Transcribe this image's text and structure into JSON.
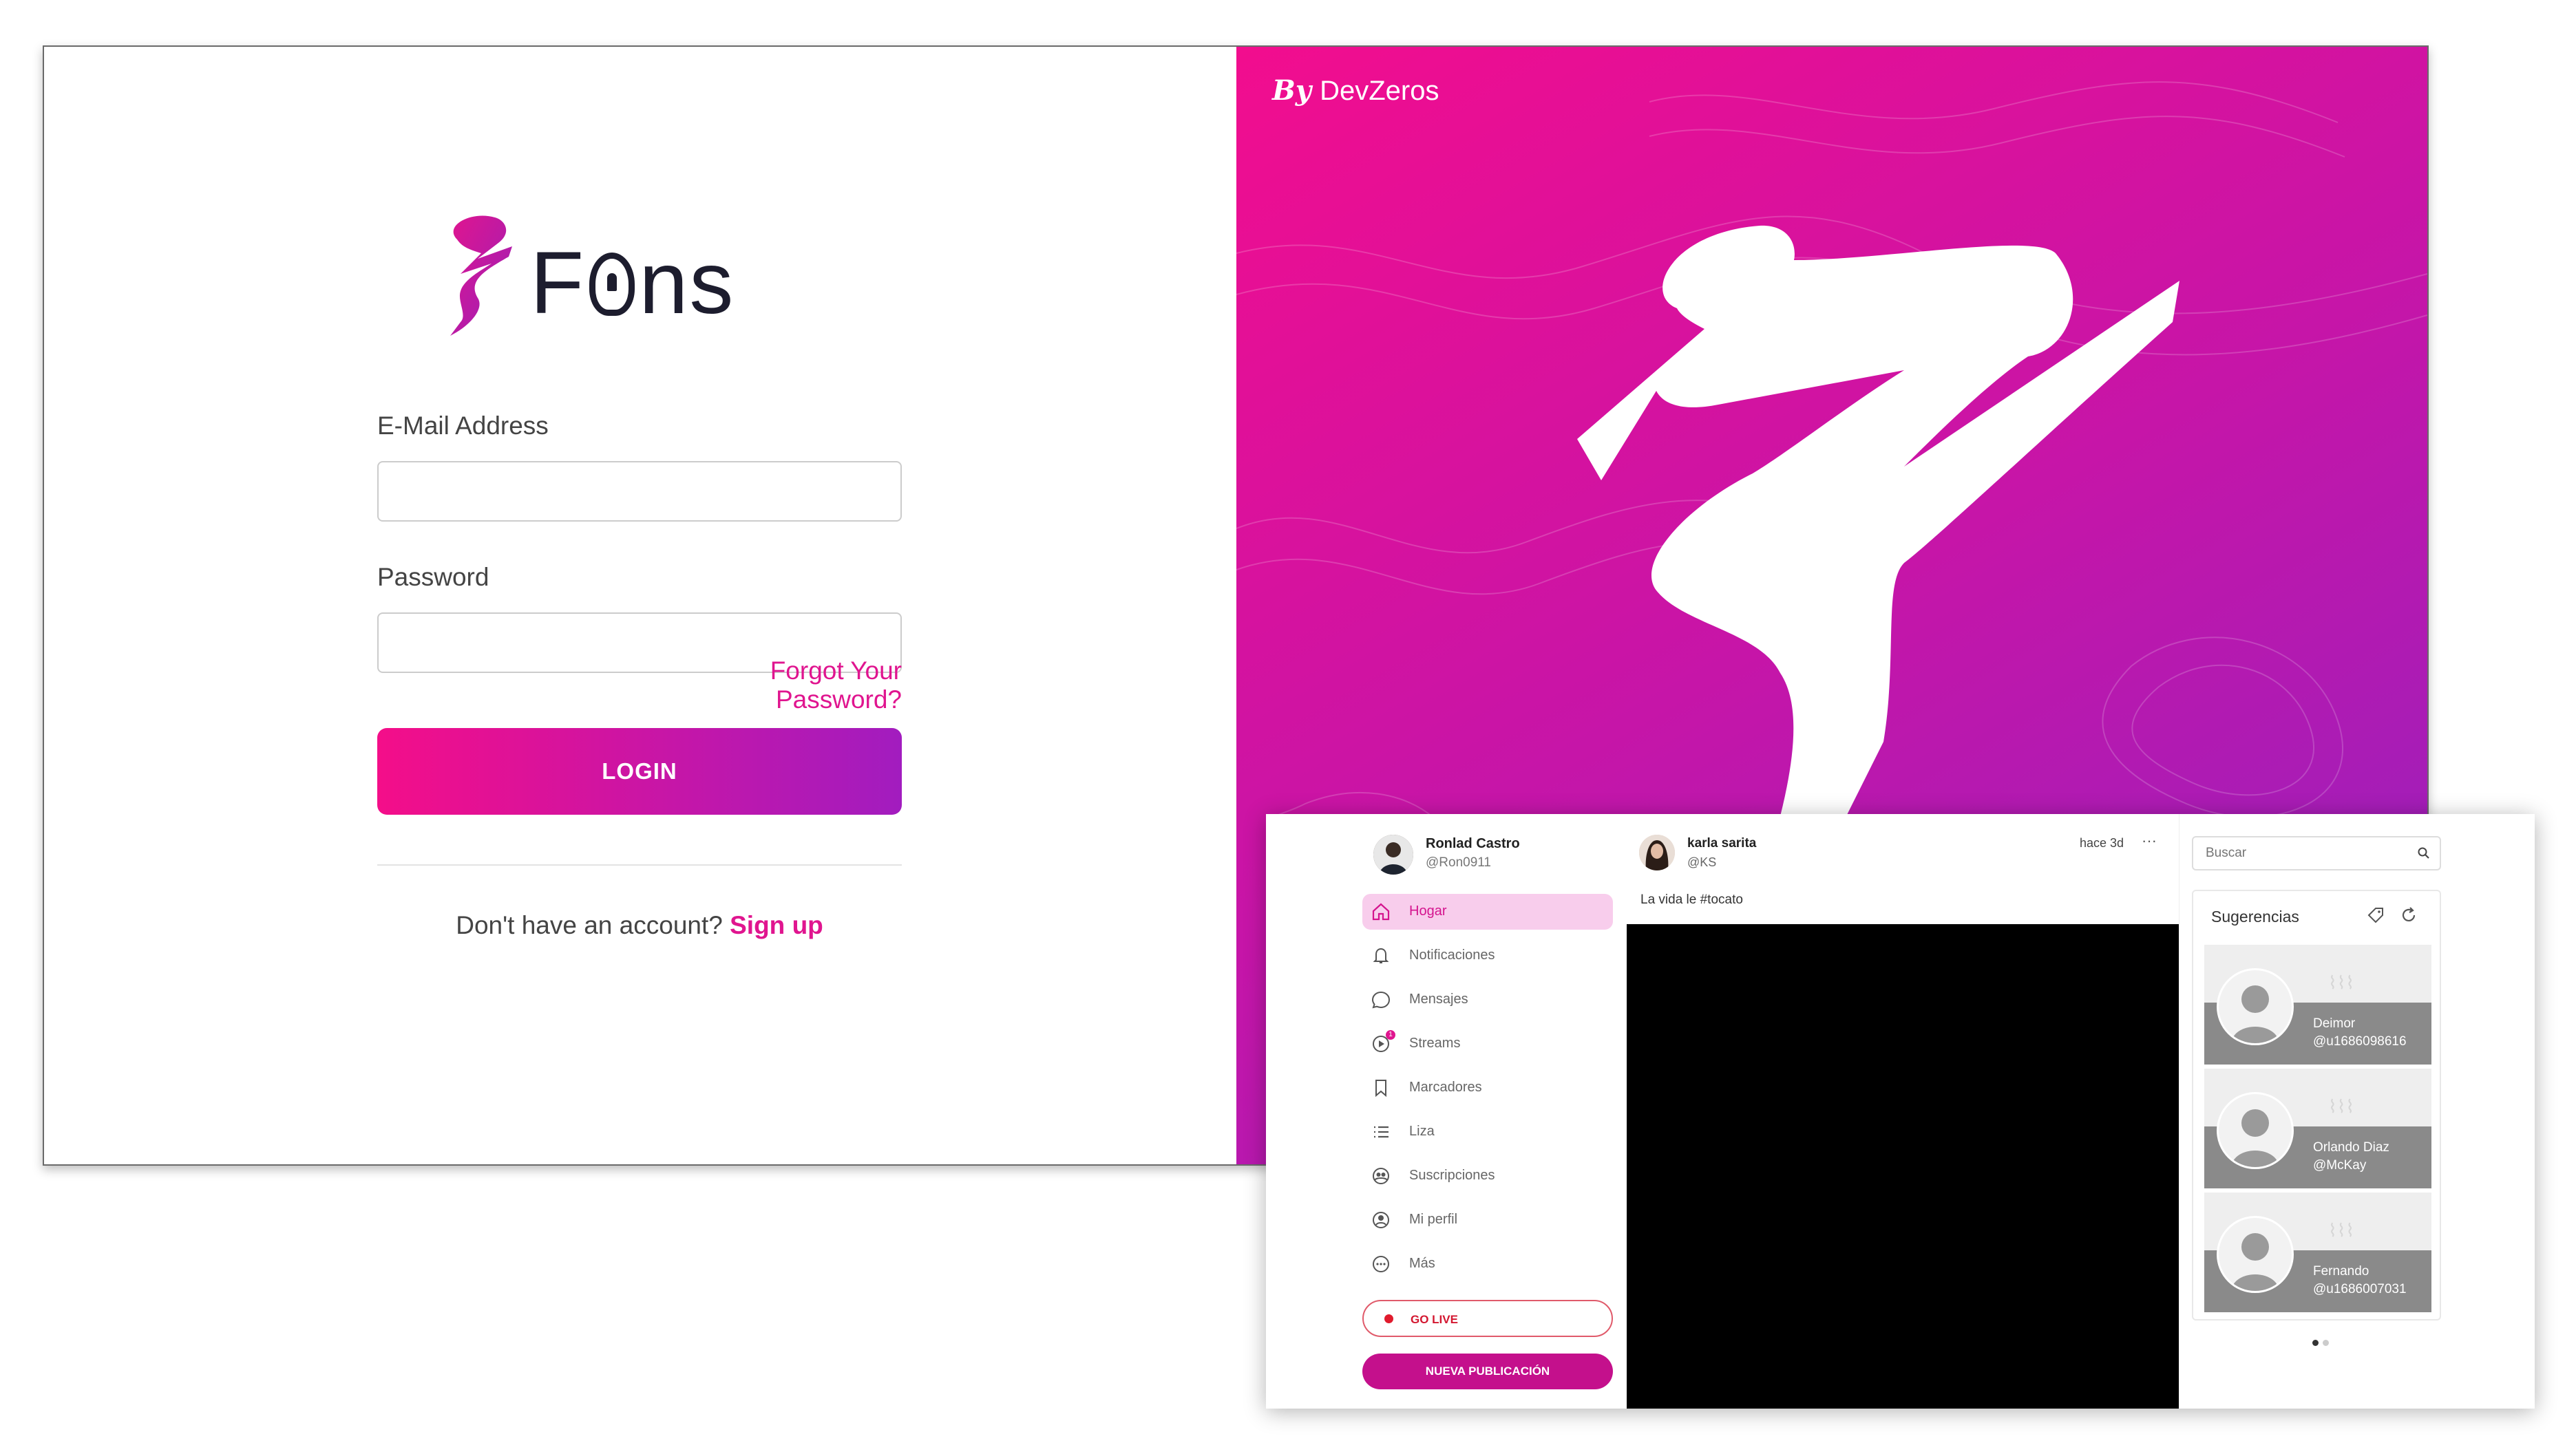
{
  "login": {
    "brand_name": "Fans",
    "email_label": "E-Mail Address",
    "email_value": "",
    "password_label": "Password",
    "password_value": "",
    "forgot_password": "Forgot Your Password?",
    "login_button": "LOGIN",
    "no_account_text": "Don't have an account?",
    "signup_link": "Sign up",
    "credit_by": "By",
    "credit_name": "DevZeros",
    "colors": {
      "accent": "#e0158f",
      "gradient_start": "#f40e89",
      "gradient_end": "#a21cbf"
    }
  },
  "app": {
    "profile": {
      "name": "Ronlad Castro",
      "handle": "@Ron0911"
    },
    "nav": [
      {
        "label": "Hogar",
        "icon": "home-icon",
        "active": true
      },
      {
        "label": "Notificaciones",
        "icon": "bell-icon"
      },
      {
        "label": "Mensajes",
        "icon": "chat-bubble-icon"
      },
      {
        "label": "Streams",
        "icon": "play-icon",
        "badge": "1"
      },
      {
        "label": "Marcadores",
        "icon": "bookmark-icon"
      },
      {
        "label": "Liza",
        "icon": "list-icon"
      },
      {
        "label": "Suscripciones",
        "icon": "subscriptions-icon"
      },
      {
        "label": "Mi perfil",
        "icon": "user-circle-icon"
      },
      {
        "label": "Más",
        "icon": "more-icon"
      }
    ],
    "go_live": "GO LIVE",
    "new_post": "NUEVA PUBLICACIÓN",
    "post": {
      "author": "karla sarita",
      "handle": "@KS",
      "time": "hace 3d",
      "more": "···",
      "text": "La vida le #tocato"
    },
    "search": {
      "placeholder": "Buscar",
      "value": ""
    },
    "suggestions": {
      "title": "Sugerencias",
      "items": [
        {
          "name": "Deimor",
          "handle": "@u1686098616"
        },
        {
          "name": "Orlando Diaz",
          "handle": "@McKay"
        },
        {
          "name": "Fernando",
          "handle": "@u1686007031"
        }
      ]
    }
  }
}
